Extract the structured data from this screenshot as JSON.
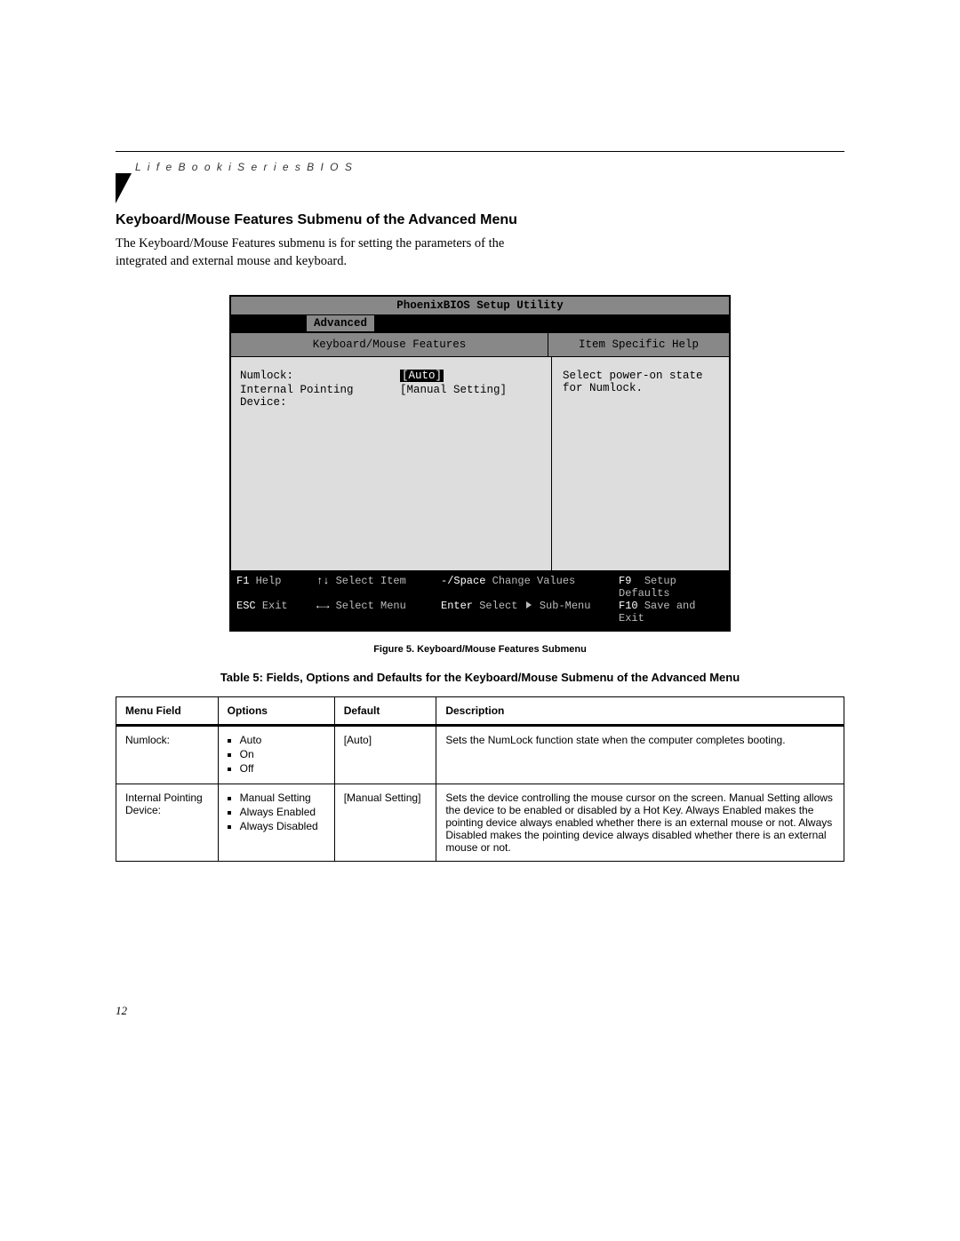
{
  "running_head": "L i f e B o o k   i   S e r i e s   B I O S",
  "section_title": "Keyboard/Mouse Features Submenu of the Advanced Menu",
  "intro": "The Keyboard/Mouse Features submenu is for setting the parameters of the integrated and external mouse and keyboard.",
  "bios": {
    "title": "PhoenixBIOS Setup Utility",
    "tab": "Advanced",
    "panel_title_left": "Keyboard/Mouse Features",
    "panel_title_right": "Item Specific Help",
    "settings": {
      "numlock_label": "Numlock:",
      "numlock_value": "[Auto]",
      "ipd_label": "Internal Pointing Device:",
      "ipd_value": "[Manual Setting]"
    },
    "help": "Select power-on state for Numlock.",
    "footer": {
      "r1": {
        "k1": "F1",
        "a1": "Help",
        "k2": "↑↓",
        "a2": "Select Item",
        "k3": "-/Space",
        "a3": "Change Values",
        "k4": "F9",
        "a4": "Setup Defaults"
      },
      "r2": {
        "k1": "ESC",
        "a1": "Exit",
        "k2": "←→",
        "a2": "Select Menu",
        "k3": "Enter",
        "a3": "Select",
        "a3b": "Sub-Menu",
        "k4": "F10",
        "a4": "Save and Exit"
      }
    }
  },
  "figure_caption": "Figure 5. Keyboard/Mouse Features Submenu",
  "table_caption": "Table 5: Fields, Options and Defaults for the Keyboard/Mouse Submenu of the Advanced Menu",
  "table": {
    "headers": {
      "c1": "Menu Field",
      "c2": "Options",
      "c3": "Default",
      "c4": "Description"
    },
    "rows": [
      {
        "field": "Numlock:",
        "options": [
          "Auto",
          "On",
          "Off"
        ],
        "default": "[Auto]",
        "desc": "Sets the NumLock function state when the computer completes booting."
      },
      {
        "field": "Internal Pointing Device:",
        "options": [
          "Manual Setting",
          "Always Enabled",
          "Always Disabled"
        ],
        "default": "[Manual Setting]",
        "desc": "Sets the device controlling the mouse cursor on the screen. Manual Setting allows the device to be enabled or disabled by a Hot Key. Always Enabled makes the pointing device always enabled whether there is an external mouse or not. Always Disabled makes the pointing device always disabled whether there is an external mouse or not."
      }
    ]
  },
  "page_number": "12"
}
